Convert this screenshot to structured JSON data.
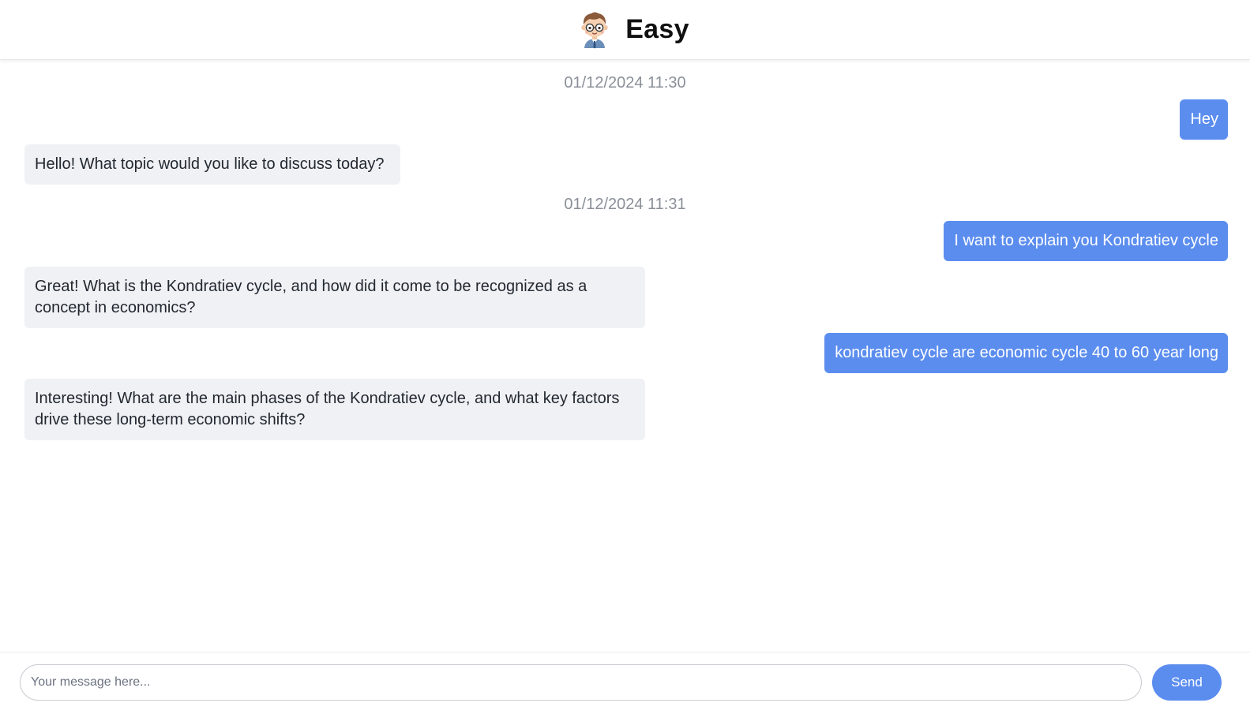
{
  "header": {
    "title": "Easy",
    "avatar_icon": "boy-with-glasses-avatar-icon"
  },
  "conversation": {
    "timestamps": [
      "01/12/2024 11:30",
      "01/12/2024 11:31"
    ],
    "messages": [
      {
        "sender": "user",
        "text": "Hey"
      },
      {
        "sender": "bot",
        "text": "Hello! What topic would you like to discuss today?"
      },
      {
        "sender": "user",
        "text": "I want to explain you Kondratiev cycle"
      },
      {
        "sender": "bot",
        "text": "Great! What is the Kondratiev cycle, and how did it come to be recognized as a concept in economics?"
      },
      {
        "sender": "user",
        "text": "kondratiev cycle are economic cycle 40 to 60 year long"
      },
      {
        "sender": "bot",
        "text": "Interesting! What are the main phases of the Kondratiev cycle, and what key factors drive these long-term economic shifts?"
      }
    ]
  },
  "composer": {
    "placeholder": "Your message here...",
    "value": "",
    "send_label": "Send"
  },
  "colors": {
    "accent": "#5b8def",
    "bot_bubble": "#f0f1f4",
    "timestamp_text": "#8a8f98"
  }
}
